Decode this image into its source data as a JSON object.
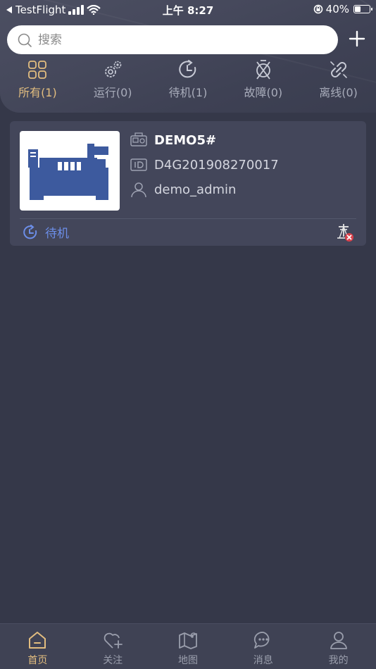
{
  "status_bar": {
    "back_app": "TestFlight",
    "time": "上午 8:27",
    "battery": "40%"
  },
  "search": {
    "placeholder": "搜索"
  },
  "filter_tabs": [
    {
      "label": "所有(1)",
      "icon": "grid-icon",
      "active": true
    },
    {
      "label": "运行(0)",
      "icon": "gears-icon",
      "active": false
    },
    {
      "label": "待机(1)",
      "icon": "standby-clock-icon",
      "active": false
    },
    {
      "label": "故障(0)",
      "icon": "fault-icon",
      "active": false
    },
    {
      "label": "离线(0)",
      "icon": "broken-link-icon",
      "active": false
    }
  ],
  "devices": [
    {
      "name": "DEMO5#",
      "id": "D4G201908270017",
      "owner": "demo_admin",
      "status": "待机",
      "status_color": "#6c8ee8"
    }
  ],
  "bottom_nav": [
    {
      "label": "首页",
      "icon": "home-icon",
      "active": true
    },
    {
      "label": "关注",
      "icon": "heart-plus-icon",
      "active": false
    },
    {
      "label": "地图",
      "icon": "map-icon",
      "active": false
    },
    {
      "label": "消息",
      "icon": "message-icon",
      "active": false
    },
    {
      "label": "我的",
      "icon": "profile-icon",
      "active": false
    }
  ],
  "colors": {
    "background": "#353849",
    "accent": "#e2bd7f",
    "standby": "#6c8ee8",
    "generator": "#3d5a9e"
  }
}
